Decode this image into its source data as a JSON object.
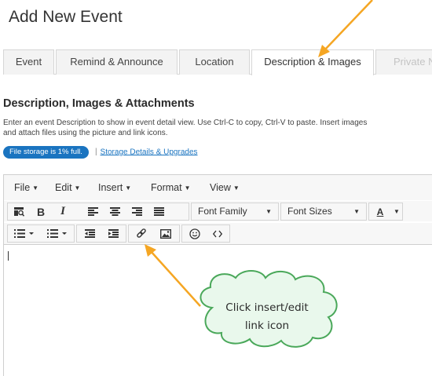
{
  "page_title": "Add New Event",
  "tabs": [
    {
      "label": "Event",
      "active": false
    },
    {
      "label": "Remind & Announce",
      "active": false
    },
    {
      "label": "Location",
      "active": false
    },
    {
      "label": "Description & Images",
      "active": true
    },
    {
      "label": "Private N",
      "active": false
    }
  ],
  "section": {
    "title": "Description, Images & Attachments",
    "intro_line1": "Enter an event Description to show in event detail view. Use Ctrl-C to copy, Ctrl-V to paste. Insert images",
    "intro_line2": "and attach files using the picture and link icons."
  },
  "storage": {
    "badge": "File storage is 1% full.",
    "separator": "|",
    "link": "Storage Details & Upgrades"
  },
  "editor": {
    "menu": [
      "File",
      "Edit",
      "Insert",
      "Format",
      "View"
    ],
    "font_family": "Font Family",
    "font_sizes": "Font Sizes",
    "text_color_letter": "A",
    "bold": "B",
    "italic": "I",
    "toolbar_icons": [
      "find-replace-icon",
      "bold-icon",
      "italic-icon",
      "align-left-icon",
      "align-center-icon",
      "align-right-icon",
      "align-justify-icon",
      "bullet-list-icon",
      "numbered-list-icon",
      "outdent-icon",
      "indent-icon",
      "link-icon",
      "image-icon",
      "emoticon-icon",
      "source-code-icon"
    ]
  },
  "callout": {
    "line1": "Click insert/edit",
    "line2": "link icon"
  },
  "colors": {
    "accent": "#1a74c0",
    "arrow": "#f5a623",
    "callout_fill": "#e9f8ec",
    "callout_border": "#4aa85a"
  }
}
